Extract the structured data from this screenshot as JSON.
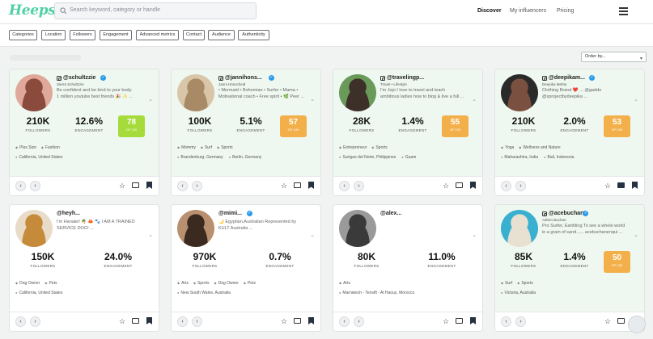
{
  "logo": "Heepsy",
  "search": {
    "placeholder": "Search keyword, category or handle"
  },
  "nav": {
    "discover": "Discover",
    "my_influencers": "My influencers",
    "pricing": "Pricing"
  },
  "filters": [
    "Categories",
    "Location",
    "Followers",
    "Engagement",
    "Advanced metrics",
    "Contact",
    "Audience",
    "Authenticity"
  ],
  "sort": {
    "label": "Order by..."
  },
  "colors": {
    "accent": "#4fd0a6",
    "score_green": "#a5db3a",
    "score_orange": "#f3b04a",
    "card_highlight": "#eef8f0",
    "verified": "#2b9be9"
  },
  "cards": [
    {
      "handle": "@schultzzie",
      "verified": true,
      "name": "Sierra Schultzzie",
      "bio": [
        "Be confident and be kind to your body.",
        "1 million youtube best friends 🎉 ✨ ..."
      ],
      "followers": "210K",
      "followers_label": "FOLLOWERS",
      "engagement": "12.6%",
      "engagement_label": "ENGAGEMENT",
      "score": "78",
      "score_of": "OF 100",
      "score_color": "green",
      "tags": [
        "Plus Size",
        "Fashion"
      ],
      "locations": [
        "California, United States"
      ],
      "highlighted": true,
      "avatar_bg": "#e0a89a",
      "avatar_fg": "#8a4a3c"
    },
    {
      "handle": "@jannihons...",
      "verified": true,
      "name": "Janni Hönscheid",
      "bio": [
        "• Mermaid • Bohemian • Surfer • Mama •",
        "Motivational coach • Free spirit • 🌿 Peer ..."
      ],
      "followers": "100K",
      "followers_label": "FOLLOWERS",
      "engagement": "5.1%",
      "engagement_label": "ENGAGEMENT",
      "score": "57",
      "score_of": "OF 100",
      "score_color": "orange",
      "tags": [
        "Mommy",
        "Surf",
        "Sports"
      ],
      "locations": [
        "Brandenburg, Germany",
        "Berlin, Germany"
      ],
      "highlighted": true,
      "avatar_bg": "#d9c6a8",
      "avatar_fg": "#a88a66"
    },
    {
      "handle": "@travelingp...",
      "verified": false,
      "name": "Travel • Lifestyle",
      "bio": [
        "I'm Jojo I love to travel and teach",
        "ambitious ladies how to blog & live a full ..."
      ],
      "followers": "28K",
      "followers_label": "FOLLOWERS",
      "engagement": "1.4%",
      "engagement_label": "ENGAGEMENT",
      "score": "55",
      "score_of": "OF 100",
      "score_color": "orange",
      "tags": [
        "Entrepreneur",
        "Sports"
      ],
      "locations": [
        "Surigao del Norte, Philippines",
        "Guam"
      ],
      "highlighted": true,
      "avatar_bg": "#6a9a5a",
      "avatar_fg": "#3c3028"
    },
    {
      "handle": "@deepikam...",
      "verified": true,
      "name": "Deepika Mehta",
      "bio": [
        "Clothing Brand ❤️ ... @gadde",
        "@sprojectbydeepika ..."
      ],
      "followers": "210K",
      "followers_label": "FOLLOWERS",
      "engagement": "2.0%",
      "engagement_label": "ENGAGEMENT",
      "score": "53",
      "score_of": "OF 100",
      "score_color": "orange",
      "tags": [
        "Yoga",
        "Wellness and Nature"
      ],
      "locations": [
        "Maharashtra, India",
        "Bali, Indonesia"
      ],
      "highlighted": true,
      "avatar_bg": "#2a2a2a",
      "avatar_fg": "#7a5040"
    },
    {
      "handle": "@heyh...",
      "verified": false,
      "name": "",
      "bio": [
        "I'm Hanalei! 🌴 🦀 🐾 I AM A TRAINED",
        "SERVICE DOG! ..."
      ],
      "followers": "150K",
      "followers_label": "FOLLOWERS",
      "engagement": "24.0%",
      "engagement_label": "ENGAGEMENT",
      "score": "",
      "score_of": "",
      "score_color": "",
      "tags": [
        "Dog Owner",
        "Pets"
      ],
      "locations": [
        "California, United States"
      ],
      "highlighted": false,
      "avatar_bg": "#e8dcc8",
      "avatar_fg": "#c58a3a"
    },
    {
      "handle": "@mimi...",
      "verified": true,
      "name": "",
      "bio": [
        "🌙 Egyptian.Australian Represented by",
        "KULT Australia ..."
      ],
      "followers": "970K",
      "followers_label": "FOLLOWERS",
      "engagement": "0.7%",
      "engagement_label": "ENGAGEMENT",
      "score": "",
      "score_of": "",
      "score_color": "",
      "tags": [
        "Arts",
        "Sports",
        "Dog Owner",
        "Pets"
      ],
      "locations": [
        "New South Wales, Australia"
      ],
      "highlighted": false,
      "avatar_bg": "#b89070",
      "avatar_fg": "#3a2a20"
    },
    {
      "handle": "@alex...",
      "verified": false,
      "name": "",
      "bio": [
        "",
        ""
      ],
      "followers": "80K",
      "followers_label": "FOLLOWERS",
      "engagement": "11.0%",
      "engagement_label": "ENGAGEMENT",
      "score": "",
      "score_of": "",
      "score_color": "",
      "tags": [
        "Arts"
      ],
      "locations": [
        "Marrakech - Tensift - Al Haouz, Morocco"
      ],
      "highlighted": false,
      "avatar_bg": "#9a9a9a",
      "avatar_fg": "#3a3a3a"
    },
    {
      "handle": "@acebuchan",
      "verified": true,
      "name": "Adrien Buchan",
      "bio": [
        "Pro Surfer, Earthling To see a whole world",
        "in a grain of sand...... acebuchanenqui ..."
      ],
      "followers": "85K",
      "followers_label": "FOLLOWERS",
      "engagement": "1.4%",
      "engagement_label": "ENGAGEMENT",
      "score": "50",
      "score_of": "OF 100",
      "score_color": "orange",
      "tags": [
        "Surf",
        "Sports"
      ],
      "locations": [
        "Victoria, Australia"
      ],
      "highlighted": true,
      "avatar_bg": "#3ab0d0",
      "avatar_fg": "#e8e0d0"
    }
  ]
}
